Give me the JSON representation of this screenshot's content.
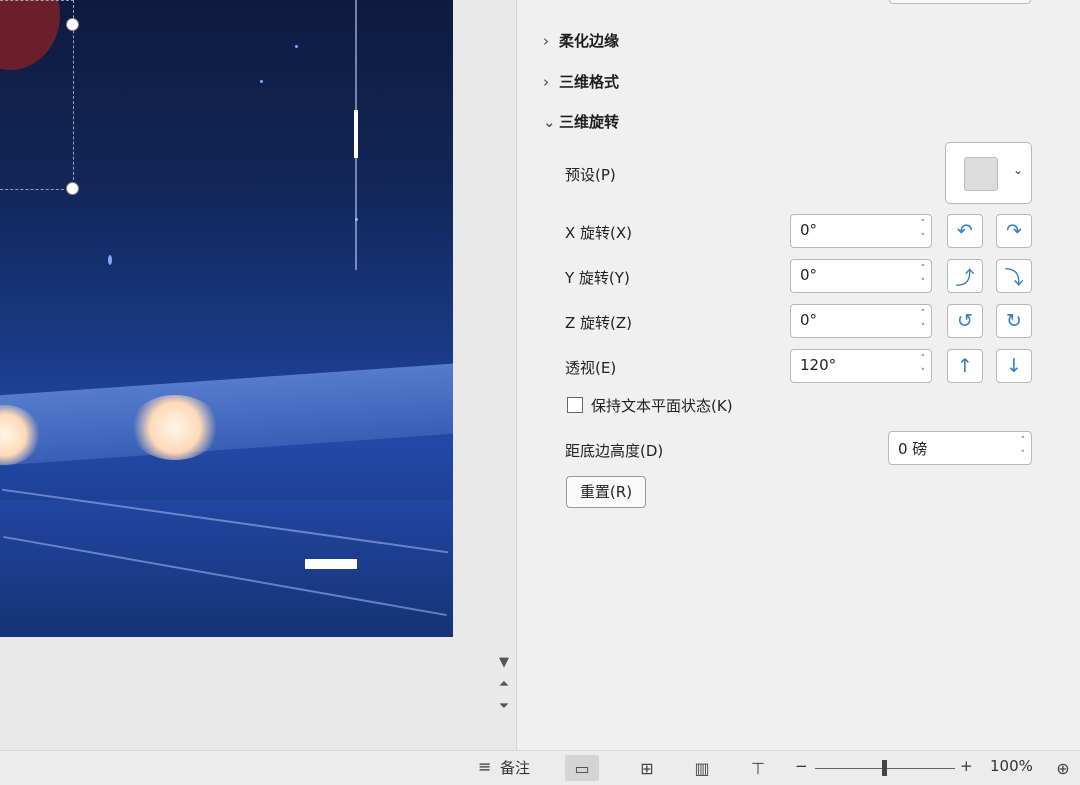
{
  "panel": {
    "sections": {
      "soft_edges": "柔化边缘",
      "format_3d": "三维格式",
      "rotation_3d": "三维旋转"
    },
    "preset_label": "预设(P)",
    "x_rotation": {
      "label": "X 旋转(X)",
      "value": "0°"
    },
    "y_rotation": {
      "label": "Y 旋转(Y)",
      "value": "0°"
    },
    "z_rotation": {
      "label": "Z 旋转(Z)",
      "value": "0°"
    },
    "perspective": {
      "label": "透视(E)",
      "value": "120°"
    },
    "keep_text_flat": {
      "label": "保持文本平面状态(K)",
      "checked": false
    },
    "distance_from_ground": {
      "label": "距底边高度(D)",
      "value": "0 磅"
    },
    "reset_label": "重置(R)"
  },
  "statusbar": {
    "notes_label": "备注",
    "zoom_minus": "−",
    "zoom_plus": "+",
    "zoom_level": "100%",
    "zoom_fraction": 0.5
  },
  "icons": {
    "chevron_right": "chevron-right-icon",
    "chevron_down": "chevron-down-icon"
  }
}
